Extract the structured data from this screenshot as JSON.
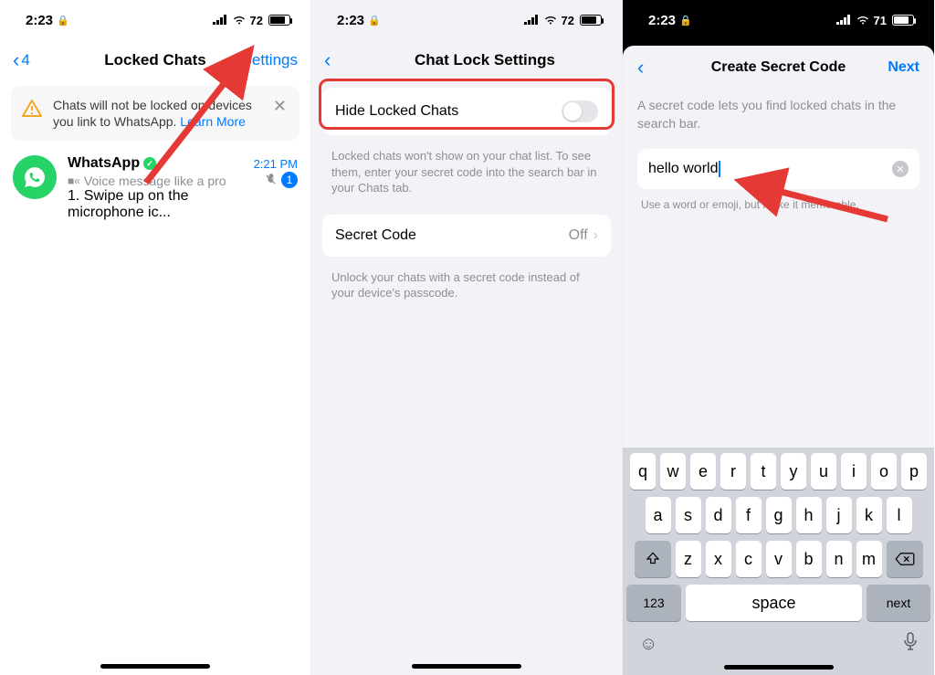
{
  "statusBar": {
    "time": "2:23",
    "battery1": "72",
    "battery2": "72",
    "battery3": "71"
  },
  "screen1": {
    "backCount": "4",
    "title": "Locked Chats",
    "settings": "Settings",
    "bannerText": "Chats will not be locked on devices you link to WhatsApp. ",
    "learnMore": "Learn More",
    "chat": {
      "name": "WhatsApp",
      "time": "2:21 PM",
      "sub": "Voice message like a pro",
      "line2": "1. Swipe up on the microphone ic...",
      "badge": "1"
    }
  },
  "screen2": {
    "title": "Chat Lock Settings",
    "hideLabel": "Hide Locked Chats",
    "hideDesc": "Locked chats won't show on your chat list. To see them, enter your secret code into the search bar in your Chats tab.",
    "secretLabel": "Secret Code",
    "secretValue": "Off",
    "secretDesc": "Unlock your chats with a secret code instead of your device's passcode."
  },
  "screen3": {
    "title": "Create Secret Code",
    "next": "Next",
    "desc": "A secret code lets you find locked chats in the search bar.",
    "inputValue": "hello world",
    "hint": "Use a word or emoji, but make it memorable."
  },
  "keyboard": {
    "row1": [
      "q",
      "w",
      "e",
      "r",
      "t",
      "y",
      "u",
      "i",
      "o",
      "p"
    ],
    "row2": [
      "a",
      "s",
      "d",
      "f",
      "g",
      "h",
      "j",
      "k",
      "l"
    ],
    "row3": [
      "z",
      "x",
      "c",
      "v",
      "b",
      "n",
      "m"
    ],
    "numKey": "123",
    "space": "space",
    "next": "next"
  }
}
